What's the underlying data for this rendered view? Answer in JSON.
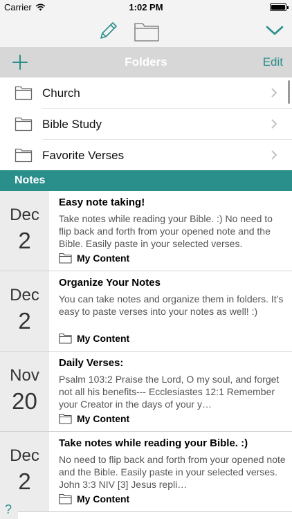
{
  "status_bar": {
    "carrier": "Carrier",
    "time": "1:02 PM",
    "icons": [
      "wifi-icon",
      "battery-icon"
    ]
  },
  "toolbar": {
    "icons": [
      "pencil-icon",
      "folder-icon",
      "chevron-down-icon"
    ]
  },
  "folders_header": {
    "title": "Folders",
    "add_icon": "plus-icon",
    "edit_label": "Edit"
  },
  "folders": [
    {
      "name": "Church"
    },
    {
      "name": "Bible Study"
    },
    {
      "name": "Favorite Verses"
    }
  ],
  "notes_header": {
    "title": "Notes"
  },
  "notes": [
    {
      "month": "Dec",
      "day": "2",
      "title": "Easy note taking!",
      "snippet": "Take notes while reading your Bible. :)   No need to flip back and forth from your opened note and the Bible. Easily paste in your selected verses.",
      "folder": "My Content"
    },
    {
      "month": "Dec",
      "day": "2",
      "title": "Organize Your Notes",
      "snippet": "You can take notes and organize them in folders. It's easy to paste verses into your notes as well! :)",
      "folder": "My Content"
    },
    {
      "month": "Nov",
      "day": "20",
      "title": "Daily Verses:",
      "snippet": "Psalm 103:2 Praise the Lord, O my soul, and forget not all his benefits---  Ecclesiastes 12:1 Remember your Creator in the days of your y…",
      "folder": "My Content"
    },
    {
      "month": "Dec",
      "day": "2",
      "title": "Take notes while reading your Bible. :)",
      "snippet": "No need to flip back and forth from your opened note and the Bible.   Easily paste in your selected verses.  John 3:3 NIV [3] Jesus repli…",
      "folder": "My Content"
    }
  ],
  "help": {
    "label": "?"
  },
  "colors": {
    "accent": "#2a8f8b",
    "header_gray": "#d7d7d7",
    "date_column": "#ececec"
  }
}
